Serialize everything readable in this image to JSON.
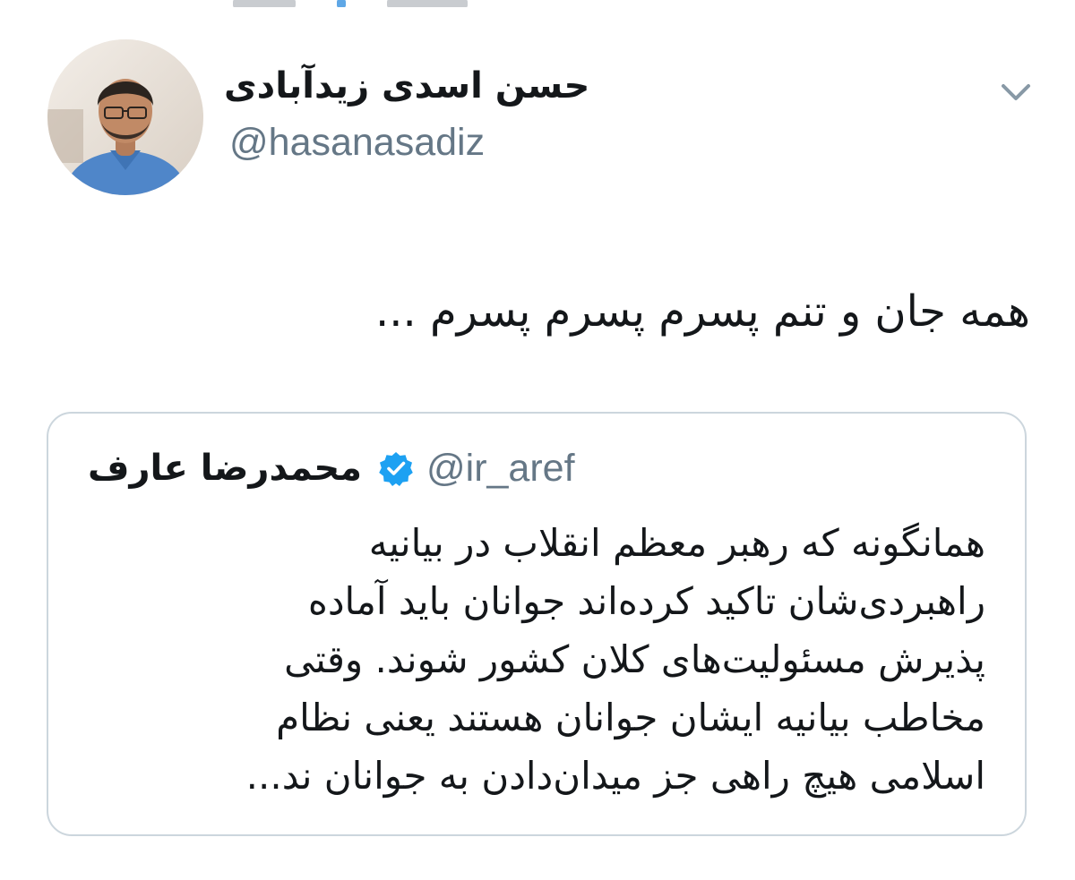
{
  "tweet": {
    "author": {
      "display_name": "حسن اسدی زیدآبادی",
      "handle": "@hasanasadiz"
    },
    "text": "همه جان و تنم پسرم پسرم پسرم ...",
    "menu_icon": "chevron-down-icon"
  },
  "quoted_tweet": {
    "author": {
      "display_name": "محمدرضا عارف",
      "handle": "@ir_aref",
      "verified_icon": "verified-badge-icon"
    },
    "text_lines": [
      "همانگونه که رهبر معظم انقلاب در بیانیه",
      "راهبردی‌شان تاکید کرده‌اند جوانان باید آماده",
      "پذیرش مسئولیت‌های کلان کشور شوند. وقتی",
      "مخاطب بیانیه ایشان جوانان هستند یعنی نظام",
      "اسلامی هیچ راهی جز میدان‌دادن به جوانان ند..."
    ]
  },
  "colors": {
    "text_primary": "#14171a",
    "text_secondary": "#657786",
    "border": "#ccd6dd",
    "verified_blue": "#1da1f2"
  }
}
